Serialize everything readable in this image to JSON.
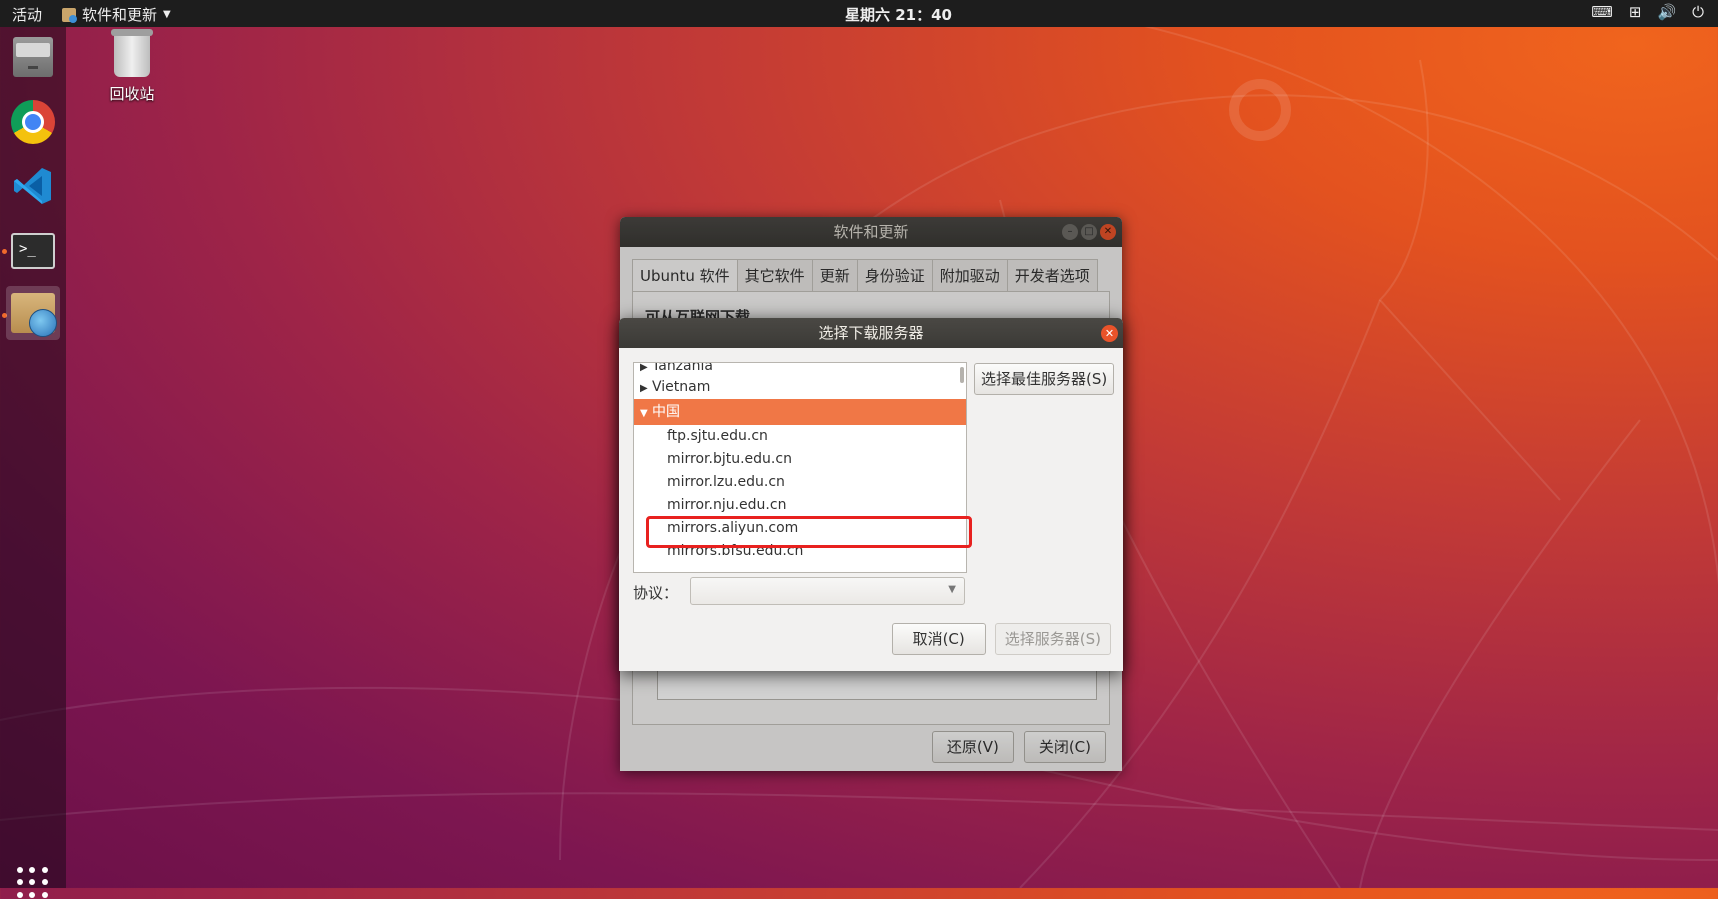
{
  "topbar": {
    "activities": "活动",
    "app_menu": "软件和更新",
    "clock": "星期六 21：40",
    "tray_icons": [
      "keyboard-icon",
      "network-icon",
      "volume-icon",
      "power-icon"
    ]
  },
  "dock": {
    "items": [
      "files-icon",
      "chrome-icon",
      "vscode-icon",
      "terminal-icon",
      "software-properties-icon"
    ],
    "terminal_glyph": ">_"
  },
  "desktop": {
    "trash_label": "回收站"
  },
  "back_window": {
    "title": "软件和更新",
    "tabs": [
      "Ubuntu 软件",
      "其它软件",
      "更新",
      "身份验证",
      "附加驱动",
      "开发者选项"
    ],
    "heading": "可从互联网下载",
    "revert_button": "还原(V)",
    "close_button": "关闭(C)"
  },
  "dialog": {
    "title": "选择下载服务器",
    "tree": [
      {
        "label": "Tanzania",
        "type": "country",
        "expanded": false
      },
      {
        "label": "Vietnam",
        "type": "country",
        "expanded": false
      },
      {
        "label": "中国",
        "type": "country",
        "expanded": true,
        "selected": true
      },
      {
        "label": "ftp.sjtu.edu.cn",
        "type": "mirror"
      },
      {
        "label": "mirror.bjtu.edu.cn",
        "type": "mirror"
      },
      {
        "label": "mirror.lzu.edu.cn",
        "type": "mirror"
      },
      {
        "label": "mirror.nju.edu.cn",
        "type": "mirror"
      },
      {
        "label": "mirrors.aliyun.com",
        "type": "mirror",
        "highlighted": true
      },
      {
        "label": "mirrors.bfsu.edu.cn",
        "type": "mirror"
      }
    ],
    "best_server_button": "选择最佳服务器(S)",
    "protocol_label": "协议：",
    "protocol_value": "",
    "cancel_button": "取消(C)",
    "choose_server_button": "选择服务器(S)"
  },
  "colors": {
    "selection": "#f07746",
    "highlight_box": "#e8211f",
    "titlebar": "#3b3a36"
  }
}
